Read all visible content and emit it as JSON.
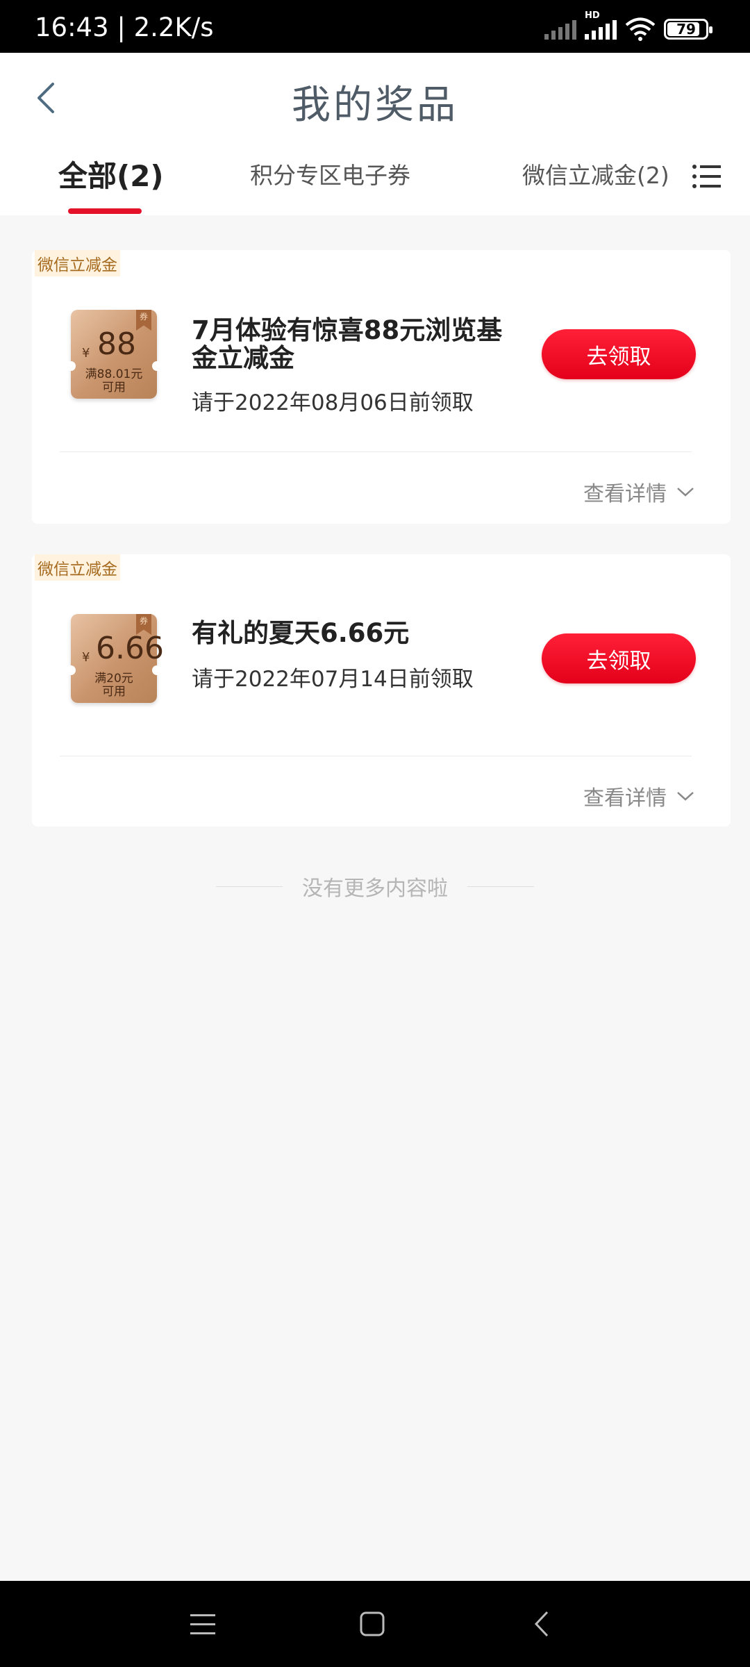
{
  "status": {
    "time": "16:43 | 2.2K/s",
    "battery": "79",
    "hd_label": "HD"
  },
  "header": {
    "title": "我的奖品"
  },
  "tabs": [
    {
      "label": "全部(2)",
      "active": true
    },
    {
      "label": "积分专区电子券",
      "active": false
    },
    {
      "label": "微信立减金(2)",
      "active": false
    }
  ],
  "prizes": [
    {
      "tag": "微信立减金",
      "coupon_symbol": "¥",
      "coupon_amount": "88",
      "coupon_condition_line1": "满88.01元",
      "coupon_condition_line2": "可用",
      "title": "7月体验有惊喜88元浏览基金立减金",
      "deadline": "请于2022年08月06日前领取",
      "button_label": "去领取",
      "details_label": "查看详情"
    },
    {
      "tag": "微信立减金",
      "coupon_symbol": "¥",
      "coupon_amount": "6.66",
      "coupon_condition_line1": "满20元",
      "coupon_condition_line2": "可用",
      "title": "有礼的夏天6.66元",
      "deadline": "请于2022年07月14日前领取",
      "button_label": "去领取",
      "details_label": "查看详情"
    }
  ],
  "footer": {
    "end_text": "没有更多内容啦"
  },
  "icons": {
    "ribbon_text": "券"
  },
  "colors": {
    "accent_red": "#e5132a",
    "tag_brown": "#a66a1e"
  }
}
